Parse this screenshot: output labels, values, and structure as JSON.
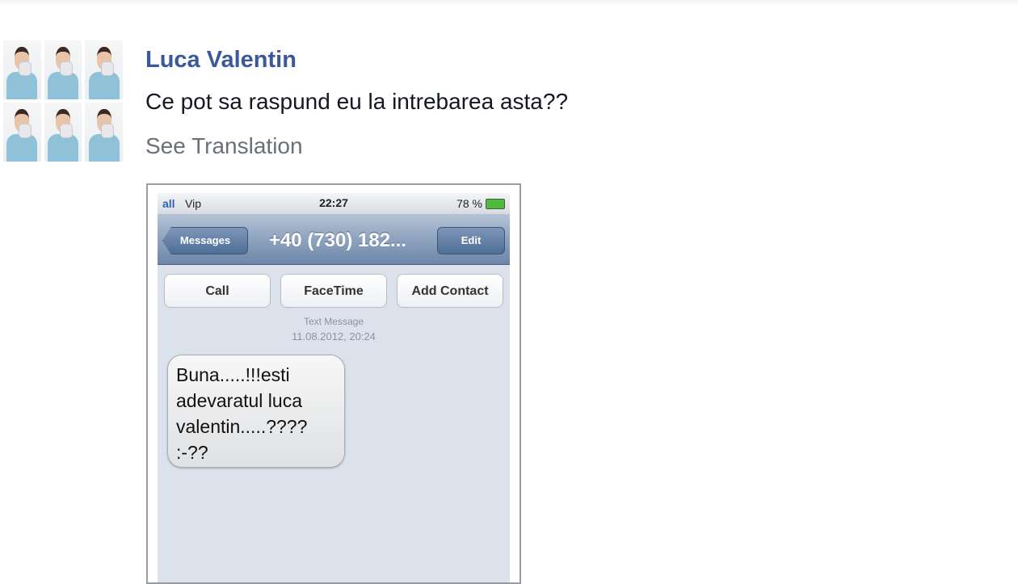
{
  "post": {
    "author": "Luca Valentin",
    "text": "Ce pot sa raspund eu la intrebarea asta??",
    "see_translation": "See Translation"
  },
  "attachment": {
    "statusbar": {
      "signal": "all",
      "carrier": "Vip",
      "time": "22:27",
      "battery": "78 %"
    },
    "navbar": {
      "back_label": "Messages",
      "title": "+40 (730) 182...",
      "edit_label": "Edit"
    },
    "actions": [
      "Call",
      "FaceTime",
      "Add Contact"
    ],
    "meta": {
      "label": "Text Message",
      "date": "11.08.2012, 20:24"
    },
    "message": "Buna.....!!!esti\nadevaratul luca\nvalentin.....????\n:-??"
  },
  "colors": {
    "link": "#3b5998",
    "body_text": "#141823",
    "muted": "#6b6f78"
  }
}
